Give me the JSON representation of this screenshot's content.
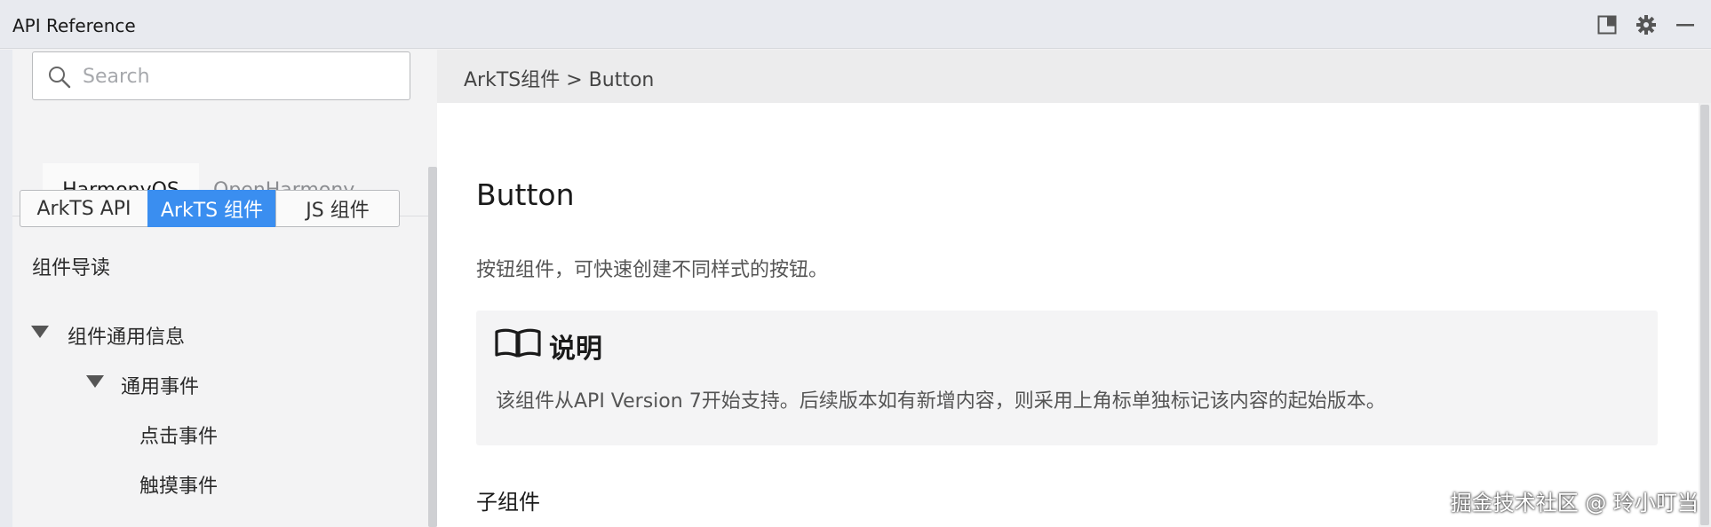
{
  "window": {
    "title": "API Reference"
  },
  "titlebar": {
    "icons": [
      "panel-toggle-icon",
      "gear-icon",
      "minimize-icon"
    ]
  },
  "sidebar": {
    "search": {
      "placeholder": "Search",
      "value": ""
    },
    "os_tabs": [
      {
        "label": "HarmonyOS",
        "active": true
      },
      {
        "label": "OpenHarmony",
        "active": false
      }
    ],
    "segments": [
      {
        "label": "ArkTS API",
        "selected": false
      },
      {
        "label": "ArkTS 组件",
        "selected": true
      },
      {
        "label": "JS 组件",
        "selected": false
      }
    ],
    "nav": {
      "guide": "组件导读",
      "common_info": "组件通用信息",
      "common_events": "通用事件",
      "click_event": "点击事件",
      "touch_event": "触摸事件"
    }
  },
  "main": {
    "breadcrumb": "ArkTS组件 > Button",
    "title": "Button",
    "description": "按钮组件，可快速创建不同样式的按钮。",
    "note": {
      "title": "说明",
      "body": "该组件从API Version 7开始支持。后续版本如有新增内容，则采用上角标单独标记该内容的起始版本。"
    },
    "subheading": "子组件"
  },
  "watermark": "掘金技术社区 @ 玲小叮当",
  "colors": {
    "accent": "#3a8ef0",
    "titlebar_bg": "#e8eaef",
    "sidebar_bg": "#f3f3f4",
    "note_bg": "#f4f4f5"
  }
}
